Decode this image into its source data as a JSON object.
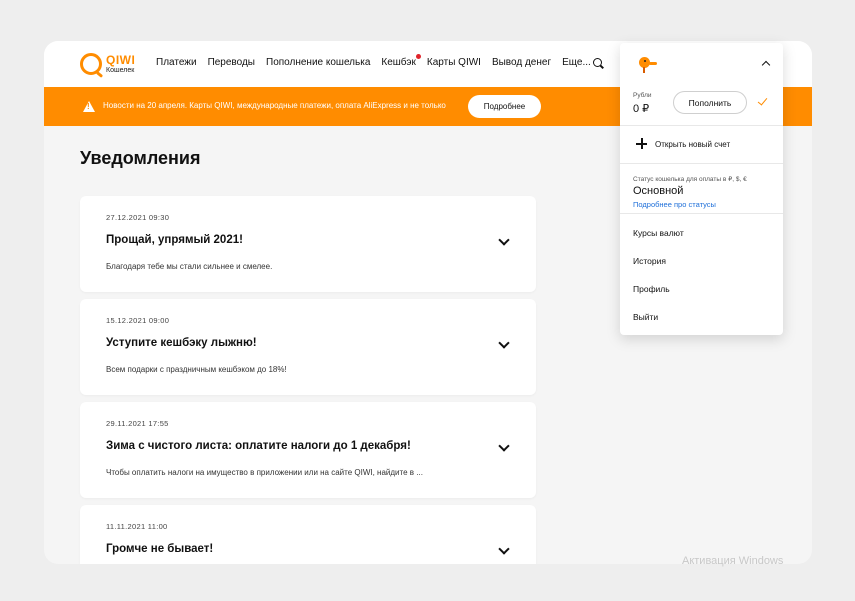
{
  "header": {
    "logo_word": "QIWI",
    "logo_sub": "Кошелек",
    "nav": [
      {
        "label": "Платежи"
      },
      {
        "label": "Переводы"
      },
      {
        "label": "Пополнение кошелька"
      },
      {
        "label": "Кешбэк",
        "badge": true
      },
      {
        "label": "Карты QIWI"
      },
      {
        "label": "Вывод денег"
      },
      {
        "label": "Еще..."
      }
    ],
    "search_icon": "search-icon"
  },
  "banner": {
    "text": "Новости на 20 апреля. Карты QIWI, международные платежи, оплата AliExpress и не только",
    "button_label": "Подробнее",
    "icon": "warning-icon"
  },
  "page": {
    "title": "Уведомления"
  },
  "notifications": [
    {
      "date": "27.12.2021 09:30",
      "title": "Прощай, упрямый 2021!",
      "text": "Благодаря тебе мы стали сильнее и смелее."
    },
    {
      "date": "15.12.2021 09:00",
      "title": "Уступите кешбэку лыжню!",
      "text": "Всем подарки с праздничным кешбэком до 18%!"
    },
    {
      "date": "29.11.2021 17:55",
      "title": "Зима с чистого листа: оплатите налоги до 1 декабря!",
      "text": "Чтобы оплатить налоги на имущество в приложении или на сайте QIWI, найдите в ..."
    },
    {
      "date": "11.11.2021 11:00",
      "title": "Громче не бывает!",
      "text": ""
    }
  ],
  "account_menu": {
    "currency_label": "Рубли",
    "amount": "0 ₽",
    "topup_label": "Пополнить",
    "open_account_label": "Открыть новый счет",
    "status_caption": "Статус кошелька для оплаты в ₽, $, €",
    "status_value": "Основной",
    "status_link": "Подробнее про статусы",
    "items": [
      "Курсы валют",
      "История",
      "Профиль",
      "Выйти"
    ]
  },
  "watermark": "Активация Windows",
  "colors": {
    "accent": "#ff8c00",
    "link": "#1e6fd9",
    "badge": "#e0242b"
  }
}
